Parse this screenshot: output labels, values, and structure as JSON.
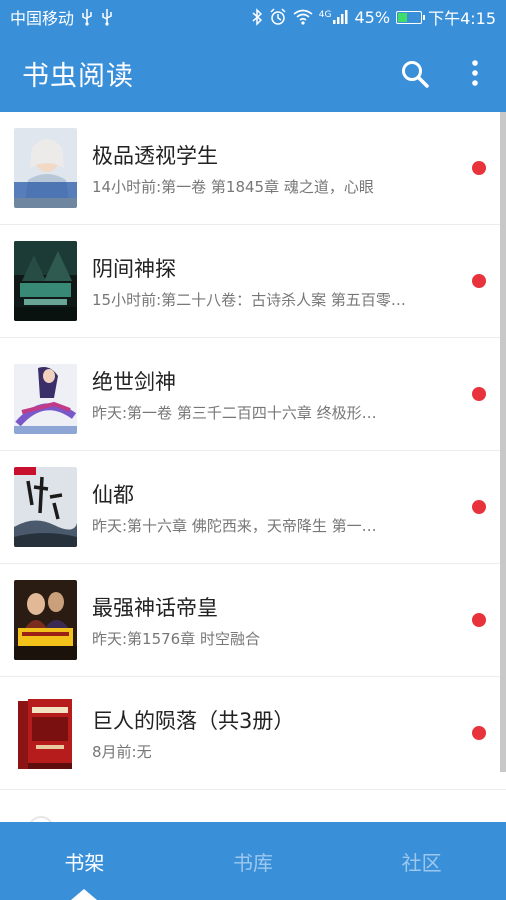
{
  "status_bar": {
    "carrier": "中国移动",
    "battery_percent": "45%",
    "time": "下午4:15",
    "network": "4G",
    "battery_level": 0.45,
    "icons": [
      "usb-icon",
      "usb-icon",
      "bluetooth-icon",
      "alarm-icon",
      "wifi-icon",
      "signal-icon",
      "battery-icon"
    ]
  },
  "app_bar": {
    "title": "书虫阅读",
    "icons": [
      "search-icon",
      "more-vert-icon"
    ]
  },
  "books": [
    {
      "title": "极品透视学生",
      "update": "14小时前:第一卷 第1845章 魂之道，心眼",
      "unread": true
    },
    {
      "title": "阴间神探",
      "update": "15小时前:第二十八卷：古诗杀人案 第五百零…",
      "unread": true
    },
    {
      "title": "绝世剑神",
      "update": "昨天:第一卷 第三千二百四十六章 终极形…",
      "unread": true
    },
    {
      "title": "仙都",
      "update": "昨天:第十六章 佛陀西来，天帝降生 第一…",
      "unread": true
    },
    {
      "title": "最强神话帝皇",
      "update": "昨天:第1576章 时空融合",
      "unread": true
    },
    {
      "title": "巨人的陨落（共3册）",
      "update": "8月前:无",
      "unread": true
    }
  ],
  "bottom_nav": {
    "tabs": [
      {
        "label": "书架",
        "active": true
      },
      {
        "label": "书库",
        "active": false
      },
      {
        "label": "社区",
        "active": false
      }
    ]
  },
  "colors": {
    "primary": "#3a8fd9",
    "unread_dot": "#e8323c",
    "tab_inactive": "#9cc8ef",
    "title_text": "#222222",
    "sub_text": "#777777"
  }
}
